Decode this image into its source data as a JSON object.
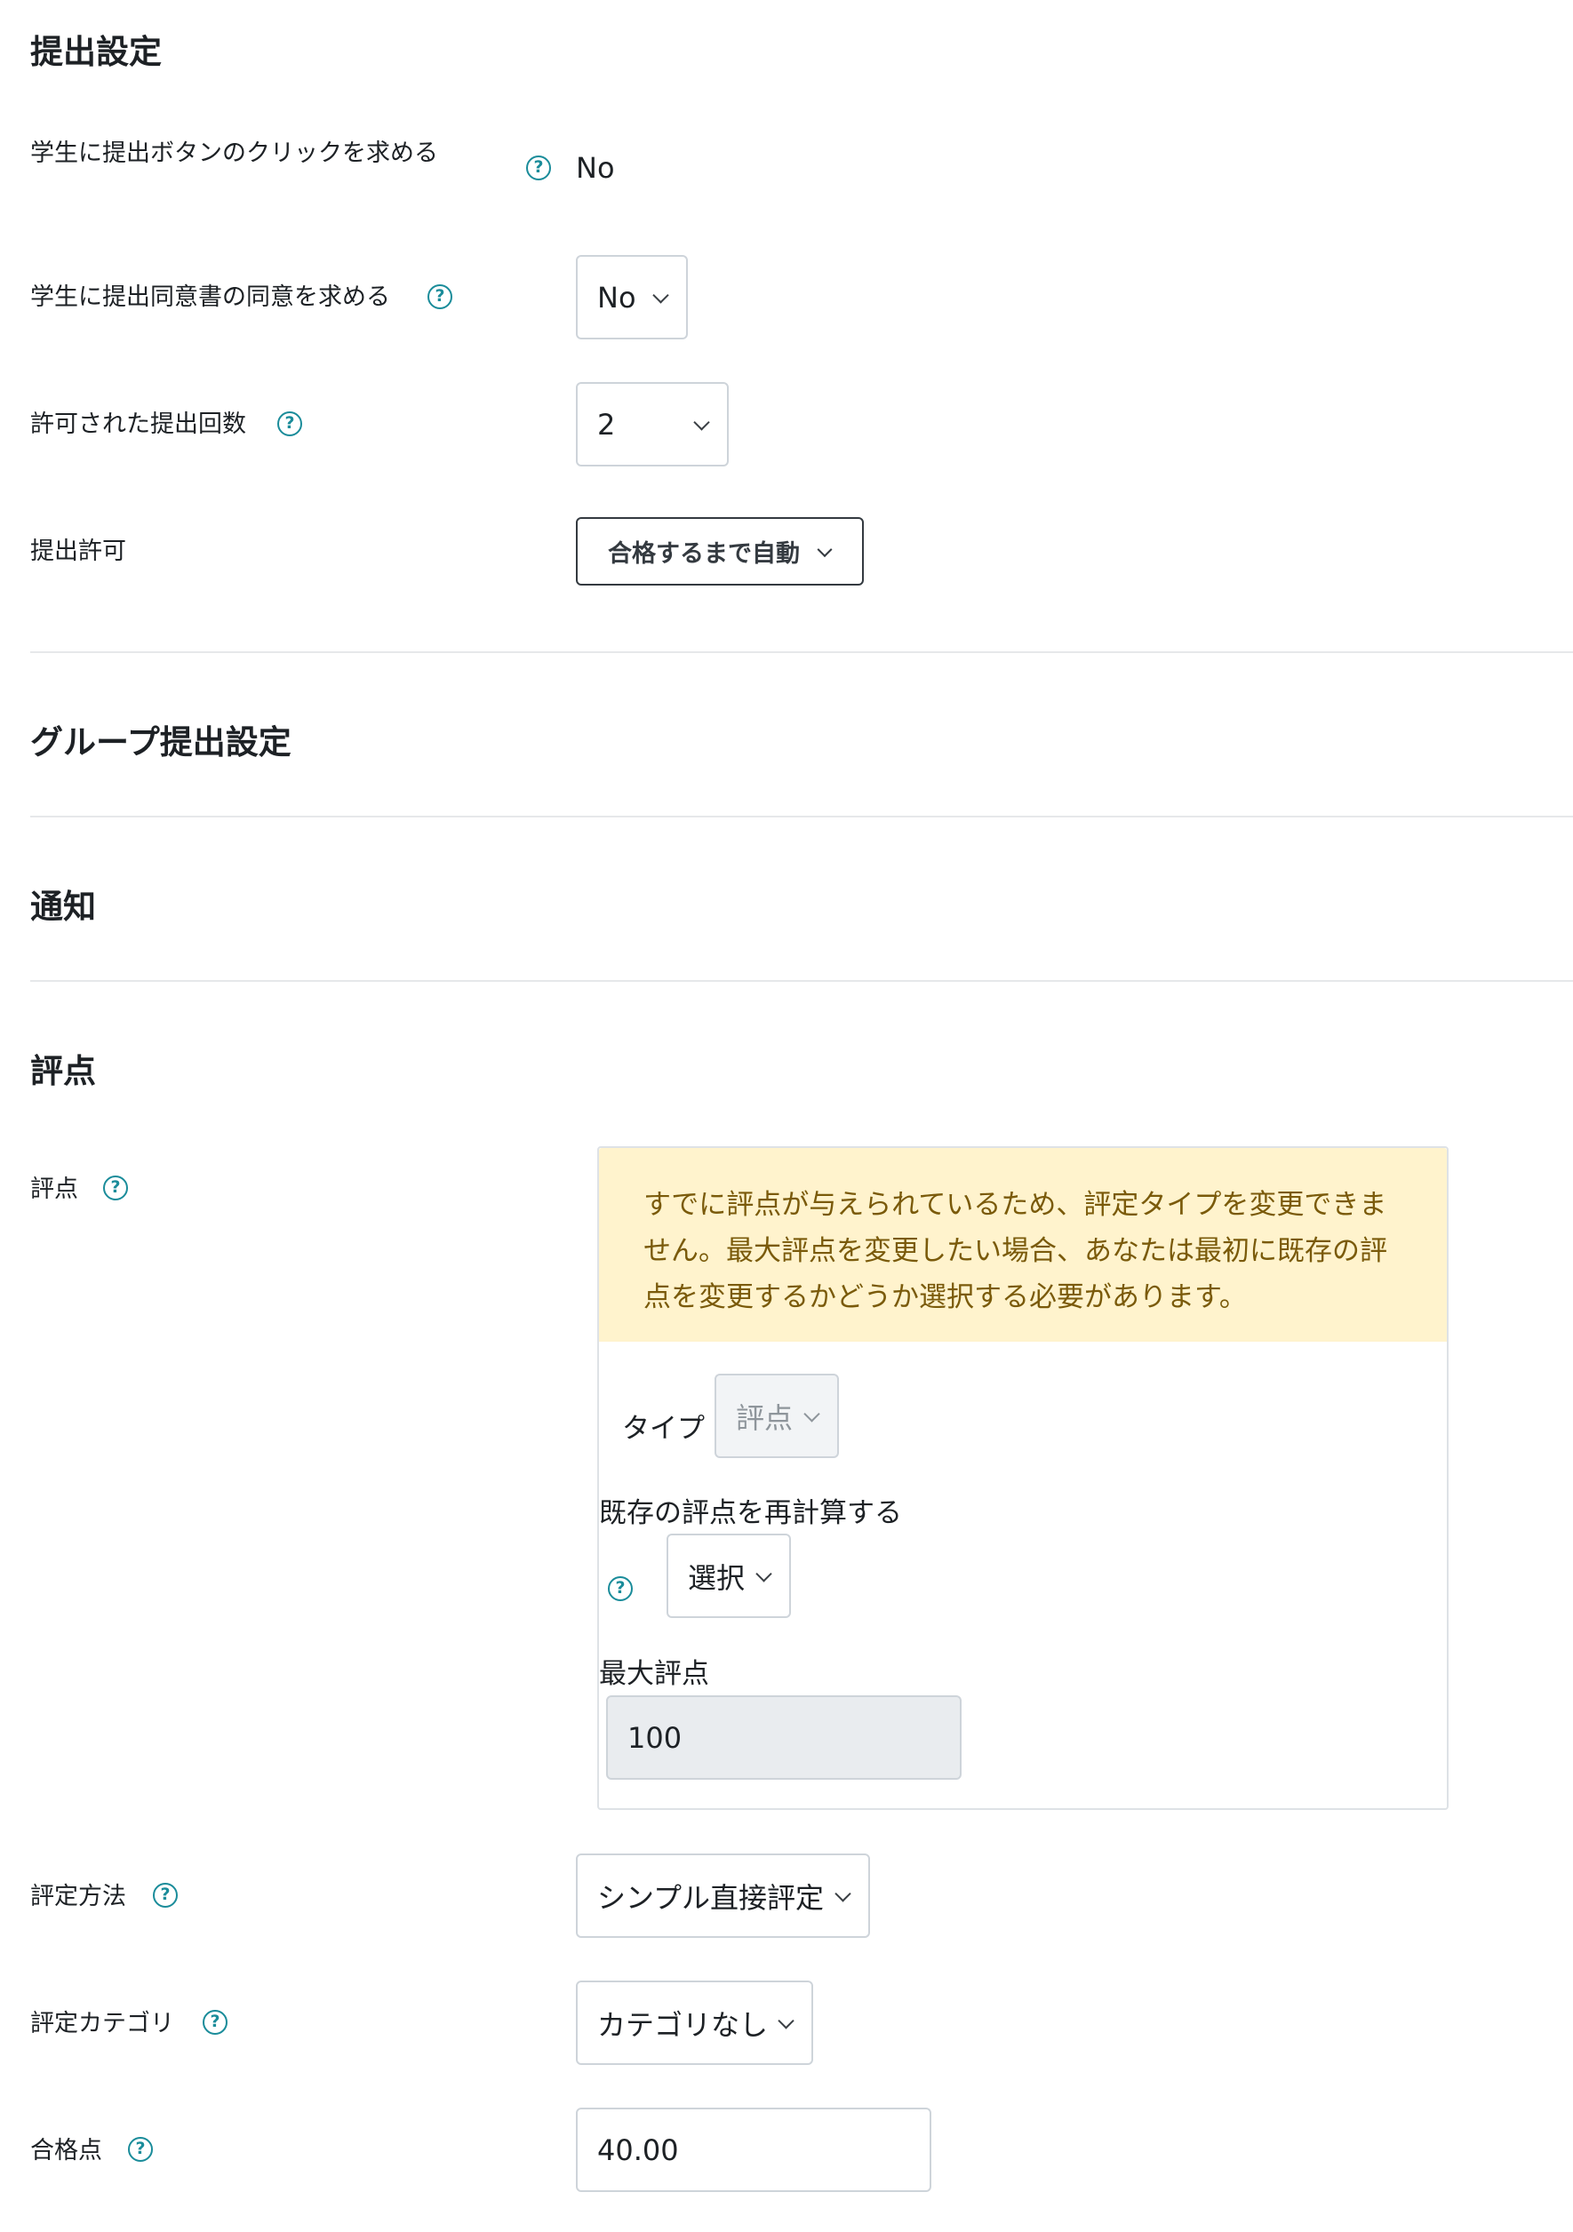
{
  "sections": {
    "submission": "提出設定",
    "group": "グループ提出設定",
    "notifications": "通知",
    "grade": "評点"
  },
  "submission": {
    "require_submit": {
      "label": "学生に提出ボタンのクリックを求める",
      "value": "No"
    },
    "require_statement": {
      "label": "学生に提出同意書の同意を求める",
      "value": "No"
    },
    "max_attempts": {
      "label": "許可された提出回数",
      "value": "2"
    },
    "reopen": {
      "label": "提出許可",
      "value": "合格するまで自動"
    }
  },
  "grade": {
    "label": "評点",
    "alert": "すでに評点が与えられているため、評定タイプを変更できません。最大評点を変更したい場合、あなたは最初に既存の評点を変更するかどうか選択する必要があります。",
    "type_label": "タイプ",
    "type_value": "評点",
    "rescale_label": "既存の評点を再計算する",
    "rescale_value": "選択",
    "max_label": "最大評点",
    "max_value": "100"
  },
  "grading_method": {
    "label": "評定方法",
    "value": "シンプル直接評定"
  },
  "grade_category": {
    "label": "評定カテゴリ",
    "value": "カテゴリなし"
  },
  "pass_grade": {
    "label": "合格点",
    "value": "40.00"
  },
  "icons": {
    "help": "?"
  },
  "colors": {
    "help_icon": "#1a8c9a",
    "alert_bg": "#fff3cd",
    "alert_text": "#7a5a0a"
  }
}
